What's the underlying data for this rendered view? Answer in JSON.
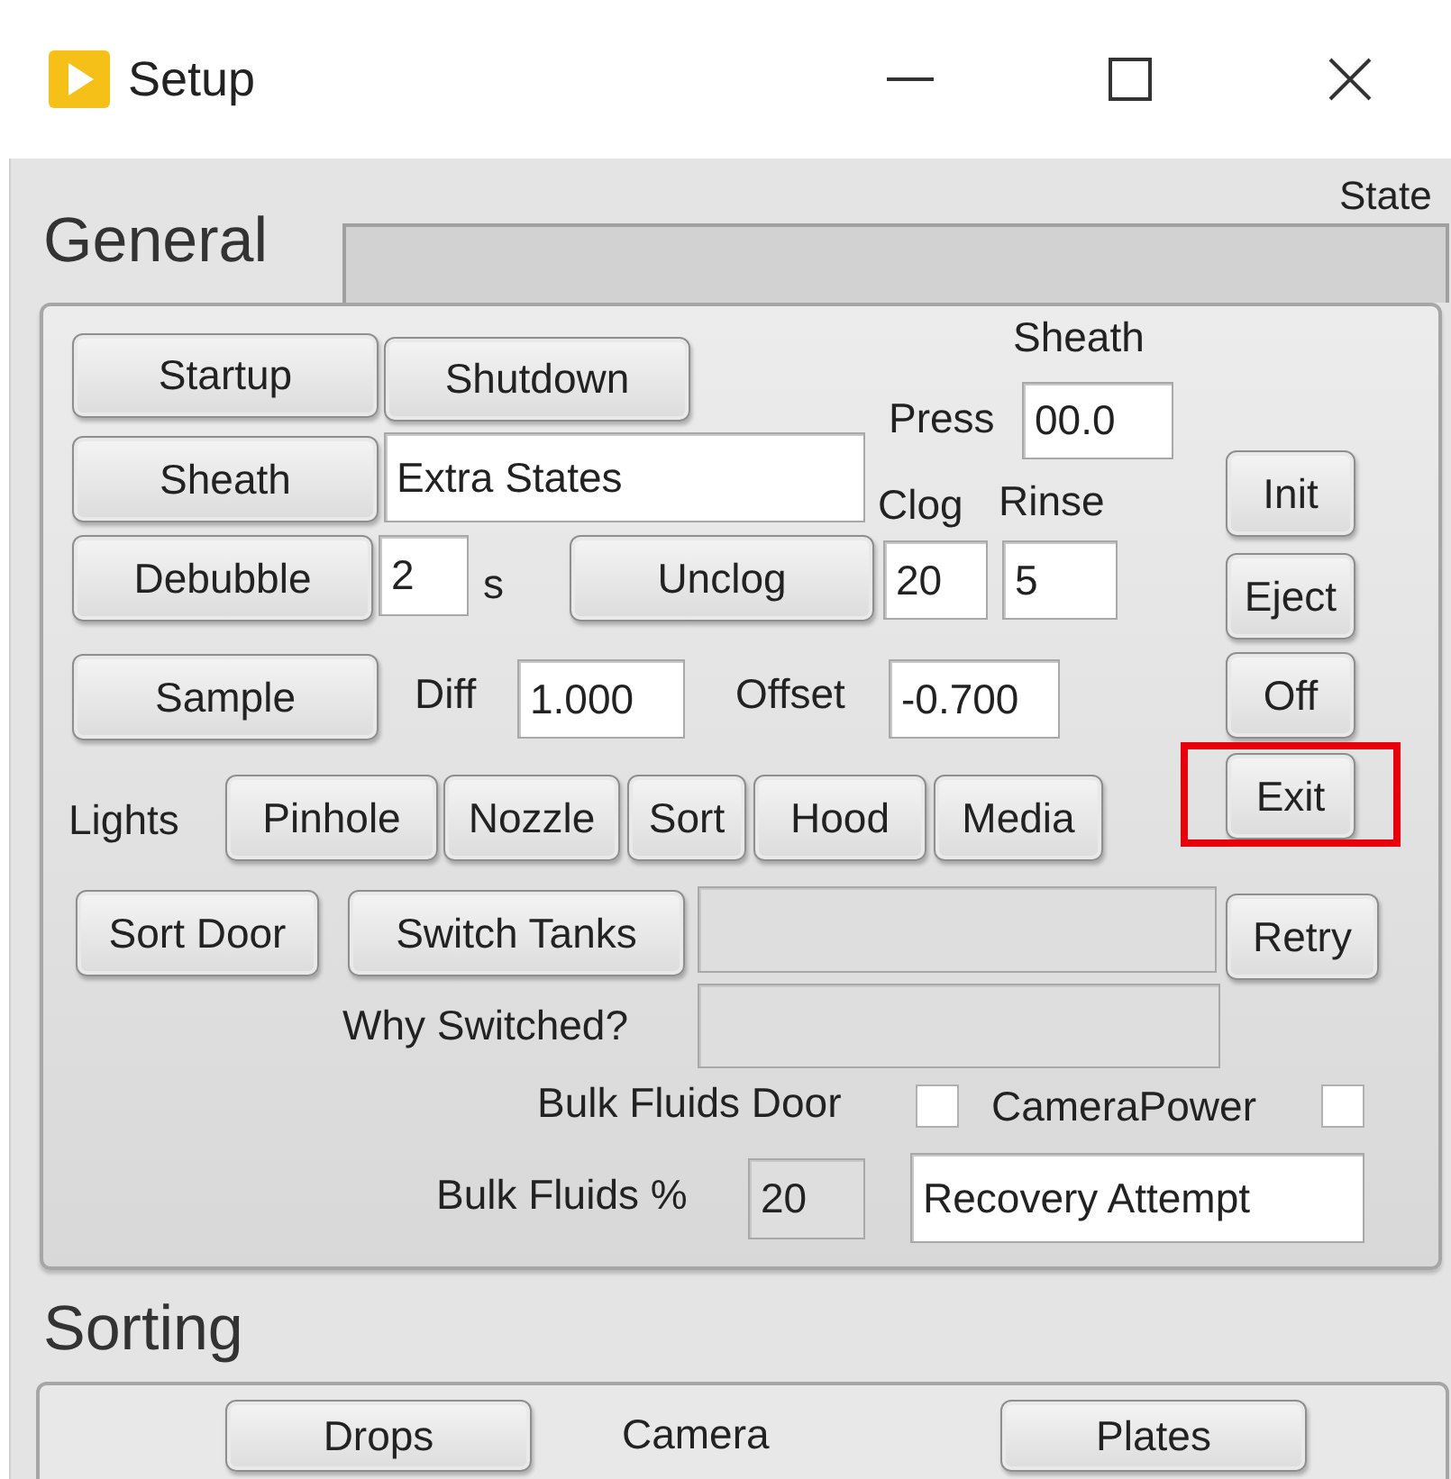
{
  "window": {
    "title": "Setup"
  },
  "state_label": "State",
  "general": {
    "title": "General",
    "controls": [
      {
        "kind": "button",
        "label": "Startup"
      },
      {
        "kind": "button",
        "label": "Shutdown"
      },
      {
        "kind": "label",
        "text": "Sheath"
      },
      {
        "kind": "label",
        "text": "Press"
      },
      {
        "kind": "field",
        "value": "00.0",
        "readonly": false
      },
      {
        "kind": "button",
        "label": "Sheath"
      },
      {
        "kind": "field",
        "value": "Extra States",
        "readonly": false
      },
      {
        "kind": "label",
        "text": "Clog"
      },
      {
        "kind": "label",
        "text": "Rinse"
      },
      {
        "kind": "button",
        "label": "Init"
      },
      {
        "kind": "button",
        "label": "Debubble"
      },
      {
        "kind": "field",
        "value": "2",
        "readonly": false
      },
      {
        "kind": "label",
        "text": "s"
      },
      {
        "kind": "button",
        "label": "Unclog"
      },
      {
        "kind": "field",
        "value": "20",
        "readonly": false
      },
      {
        "kind": "field",
        "value": "5",
        "readonly": false
      },
      {
        "kind": "button",
        "label": "Eject"
      },
      {
        "kind": "button",
        "label": "Sample"
      },
      {
        "kind": "label",
        "text": "Diff"
      },
      {
        "kind": "field",
        "value": "1.000",
        "readonly": false
      },
      {
        "kind": "label",
        "text": "Offset"
      },
      {
        "kind": "field",
        "value": "-0.700",
        "readonly": false
      },
      {
        "kind": "button",
        "label": "Off"
      },
      {
        "kind": "label",
        "text": "Lights"
      },
      {
        "kind": "button",
        "label": "Pinhole"
      },
      {
        "kind": "button",
        "label": "Nozzle"
      },
      {
        "kind": "button",
        "label": "Sort"
      },
      {
        "kind": "button",
        "label": "Hood"
      },
      {
        "kind": "button",
        "label": "Media"
      },
      {
        "kind": "button",
        "label": "Exit",
        "highlighted": true
      },
      {
        "kind": "button",
        "label": "Sort Door"
      },
      {
        "kind": "button",
        "label": "Switch Tanks"
      },
      {
        "kind": "field",
        "readonly": true
      },
      {
        "kind": "button",
        "label": "Retry"
      },
      {
        "kind": "label",
        "text": "Why Switched?"
      },
      {
        "kind": "field",
        "readonly": true
      },
      {
        "kind": "label",
        "text": "Bulk Fluids Door"
      },
      {
        "kind": "checkbox",
        "checked": false
      },
      {
        "kind": "label",
        "text": "CameraPower"
      },
      {
        "kind": "checkbox",
        "checked": false
      },
      {
        "kind": "label",
        "text": "Bulk Fluids %"
      },
      {
        "kind": "field",
        "value": "20",
        "readonly": true
      },
      {
        "kind": "field",
        "value": "Recovery Attempt",
        "readonly": false
      }
    ]
  },
  "sorting": {
    "title": "Sorting",
    "controls": [
      {
        "kind": "button",
        "label": "Drops"
      },
      {
        "kind": "label",
        "text": "Camera"
      },
      {
        "kind": "button",
        "label": "Plates"
      }
    ]
  }
}
